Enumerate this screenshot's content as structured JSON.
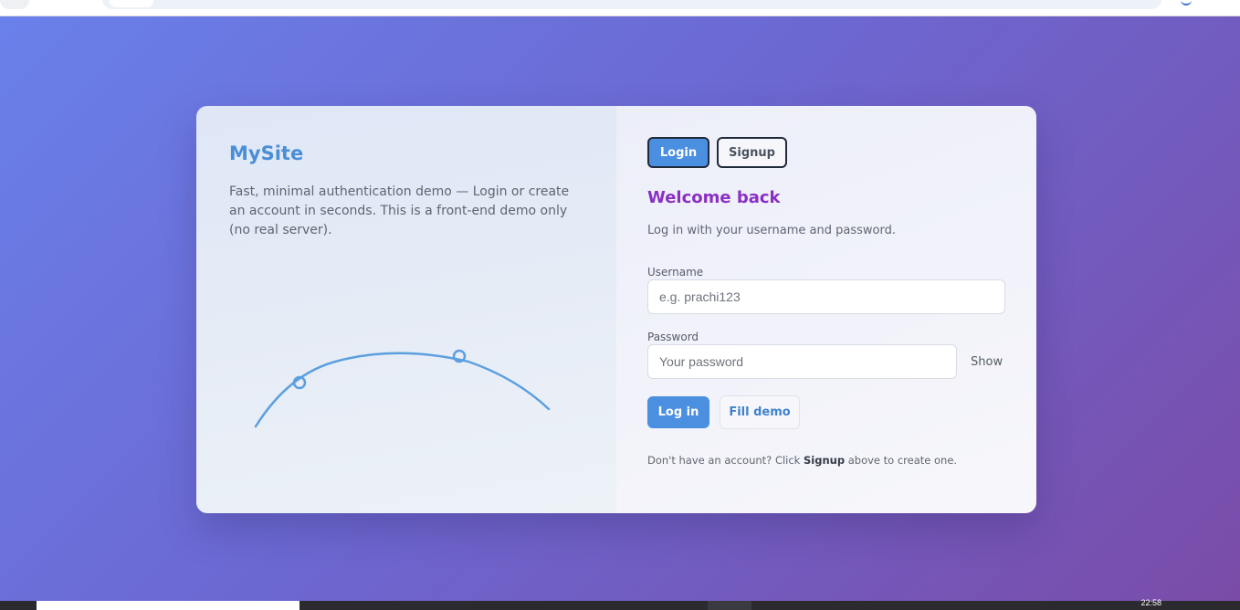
{
  "left_panel": {
    "brand": "MySite",
    "description": "Fast, minimal authentication demo — Login or create an account in seconds. This is a front-end demo only (no real server)."
  },
  "tabs": {
    "login_label": "Login",
    "signup_label": "Signup",
    "active": "Login"
  },
  "form": {
    "heading": "Welcome back",
    "subheading": "Log in with your username and password.",
    "username_label": "Username",
    "username_placeholder": "e.g. prachi123",
    "password_label": "Password",
    "password_placeholder": "Your password",
    "show_label": "Show",
    "submit_label": "Log in",
    "fill_demo_label": "Fill demo"
  },
  "footer": {
    "prefix": "Don't have an account? Click ",
    "link": "Signup",
    "suffix": " above to create one."
  },
  "taskbar": {
    "clock": "22:58"
  },
  "colors": {
    "accent_blue": "#4a8fe0",
    "heading_purple": "#8a2fc4",
    "brand_blue": "#4a8fd6"
  }
}
